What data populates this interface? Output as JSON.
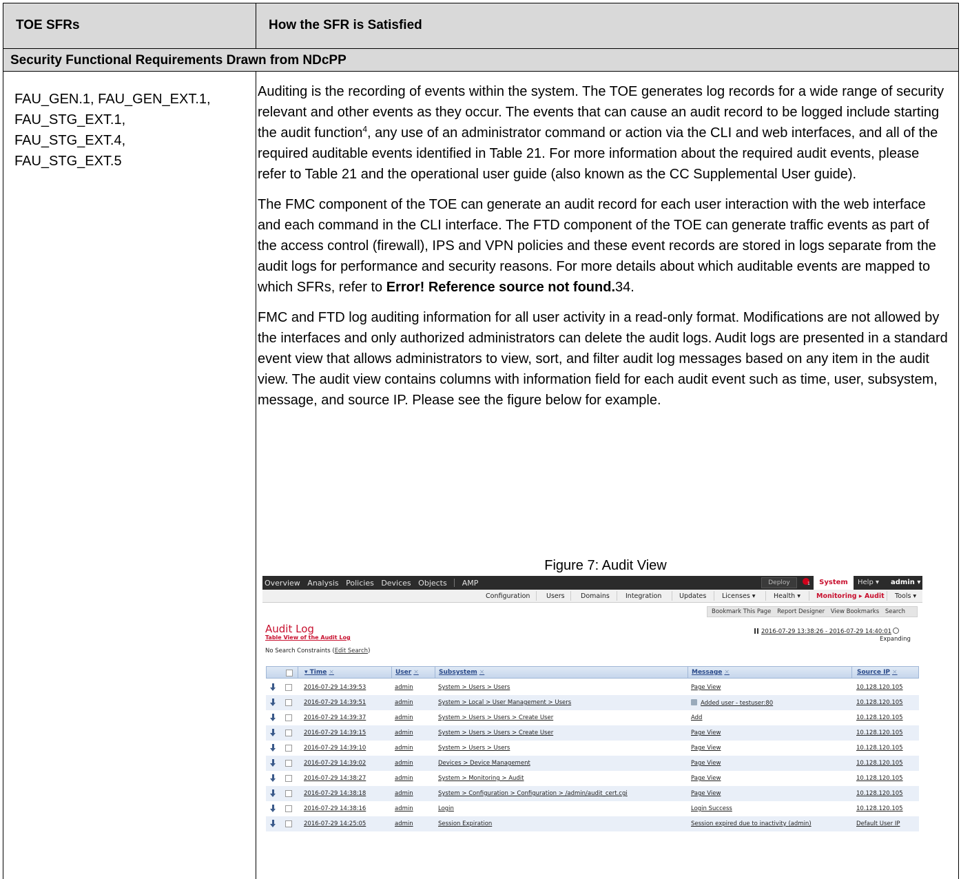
{
  "table": {
    "col1_header": "TOE SFRs",
    "col2_header": "How the SFR is Satisfied",
    "section_header": "Security Functional Requirements Drawn from NDcPP",
    "sfrs": [
      "FAU_GEN.1, FAU_GEN_EXT.1,",
      "FAU_STG_EXT.1,",
      "FAU_STG_EXT.4,",
      "FAU_STG_EXT.5"
    ],
    "para1_a": "Auditing is the recording of events within the system. The TOE generates log records for a wide range of security relevant and other events as they occur. The events that can cause an audit record to be logged include starting the audit function",
    "para1_footnote": "4",
    "para1_b": ", any use of an administrator command or action via the CLI and web interfaces, and all of the required auditable events identified in Table 21. For more information about the required audit events, please refer to Table 21 and the operational user guide (also known as the CC Supplemental User guide).",
    "para2_a": "The FMC component of the TOE can generate an audit record for each user interaction with the web interface and each command in the CLI interface.  The FTD component of the TOE can generate traffic events as part of the access control (firewall), IPS and VPN policies and these event records are stored in logs separate from the audit logs for performance and security reasons.  For more details about which auditable events are mapped to which SFRs, refer to ",
    "para2_bold": "Error! Reference source not found.",
    "para2_c": "34.",
    "para3": "FMC and FTD log auditing information for all user activity in a read-only format. Modifications are not allowed by the interfaces and only authorized administrators can delete the audit logs. Audit logs are presented in a standard event view that allows administrators to view, sort, and filter audit log messages based on any item in the audit view. The audit view contains columns with information field for each audit event such as time, user, subsystem, message, and source IP. Please see the figure below for example.",
    "figure_caption": "Figure 7: Audit View"
  },
  "fmc": {
    "nav": [
      "Overview",
      "Analysis",
      "Policies",
      "Devices",
      "Objects",
      "AMP"
    ],
    "deploy": "Deploy",
    "alert_count": "1",
    "system": "System",
    "help": "Help ▾",
    "admin": "admin ▾",
    "subnav": [
      "Configuration",
      "Users",
      "Domains",
      "Integration",
      "Updates",
      "Licenses ▾",
      "Health ▾",
      "Monitoring ▸ Audit",
      "Tools ▾"
    ],
    "bookmarks": [
      "Bookmark This Page",
      "Report Designer",
      "View Bookmarks",
      "Search"
    ],
    "title": "Audit Log",
    "table_view_link": "Table View of the Audit Log",
    "range": "2016-07-29 13:38:26 - 2016-07-29 14:40:01",
    "expanding": "Expanding",
    "constraints_prefix": "No Search Constraints (",
    "constraints_link": "Edit Search",
    "constraints_suffix": ")",
    "columns": {
      "time": "▾ Time",
      "user": "User",
      "subsystem": "Subsystem",
      "message": "Message",
      "source_ip": "Source IP",
      "remove": "×"
    },
    "rows": [
      {
        "time": "2016-07-29 14:39:53",
        "user": "admin",
        "subsystem": "System > Users > Users",
        "message": "Page View",
        "ip": "10.128.120.105"
      },
      {
        "time": "2016-07-29 14:39:51",
        "user": "admin",
        "subsystem": "System > Local > User Management > Users",
        "message": "Added user - testuser:80",
        "ip": "10.128.120.105"
      },
      {
        "time": "2016-07-29 14:39:37",
        "user": "admin",
        "subsystem": "System > Users > Users > Create User",
        "message": "Add",
        "ip": "10.128.120.105"
      },
      {
        "time": "2016-07-29 14:39:15",
        "user": "admin",
        "subsystem": "System > Users > Users > Create User",
        "message": "Page View",
        "ip": "10.128.120.105"
      },
      {
        "time": "2016-07-29 14:39:10",
        "user": "admin",
        "subsystem": "System > Users > Users",
        "message": "Page View",
        "ip": "10.128.120.105"
      },
      {
        "time": "2016-07-29 14:39:02",
        "user": "admin",
        "subsystem": "Devices > Device Management",
        "message": "Page View",
        "ip": "10.128.120.105"
      },
      {
        "time": "2016-07-29 14:38:27",
        "user": "admin",
        "subsystem": "System > Monitoring > Audit",
        "message": "Page View",
        "ip": "10.128.120.105"
      },
      {
        "time": "2016-07-29 14:38:18",
        "user": "admin",
        "subsystem": "System > Configuration > Configuration > /admin/audit_cert.cgi",
        "message": "Page View",
        "ip": "10.128.120.105"
      },
      {
        "time": "2016-07-29 14:38:16",
        "user": "admin",
        "subsystem": "Login",
        "message": "Login Success",
        "ip": "10.128.120.105"
      },
      {
        "time": "2016-07-29 14:25:05",
        "user": "admin",
        "subsystem": "Session Expiration",
        "message": "Session expired due to inactivity (admin)",
        "ip": "Default User IP"
      }
    ]
  }
}
